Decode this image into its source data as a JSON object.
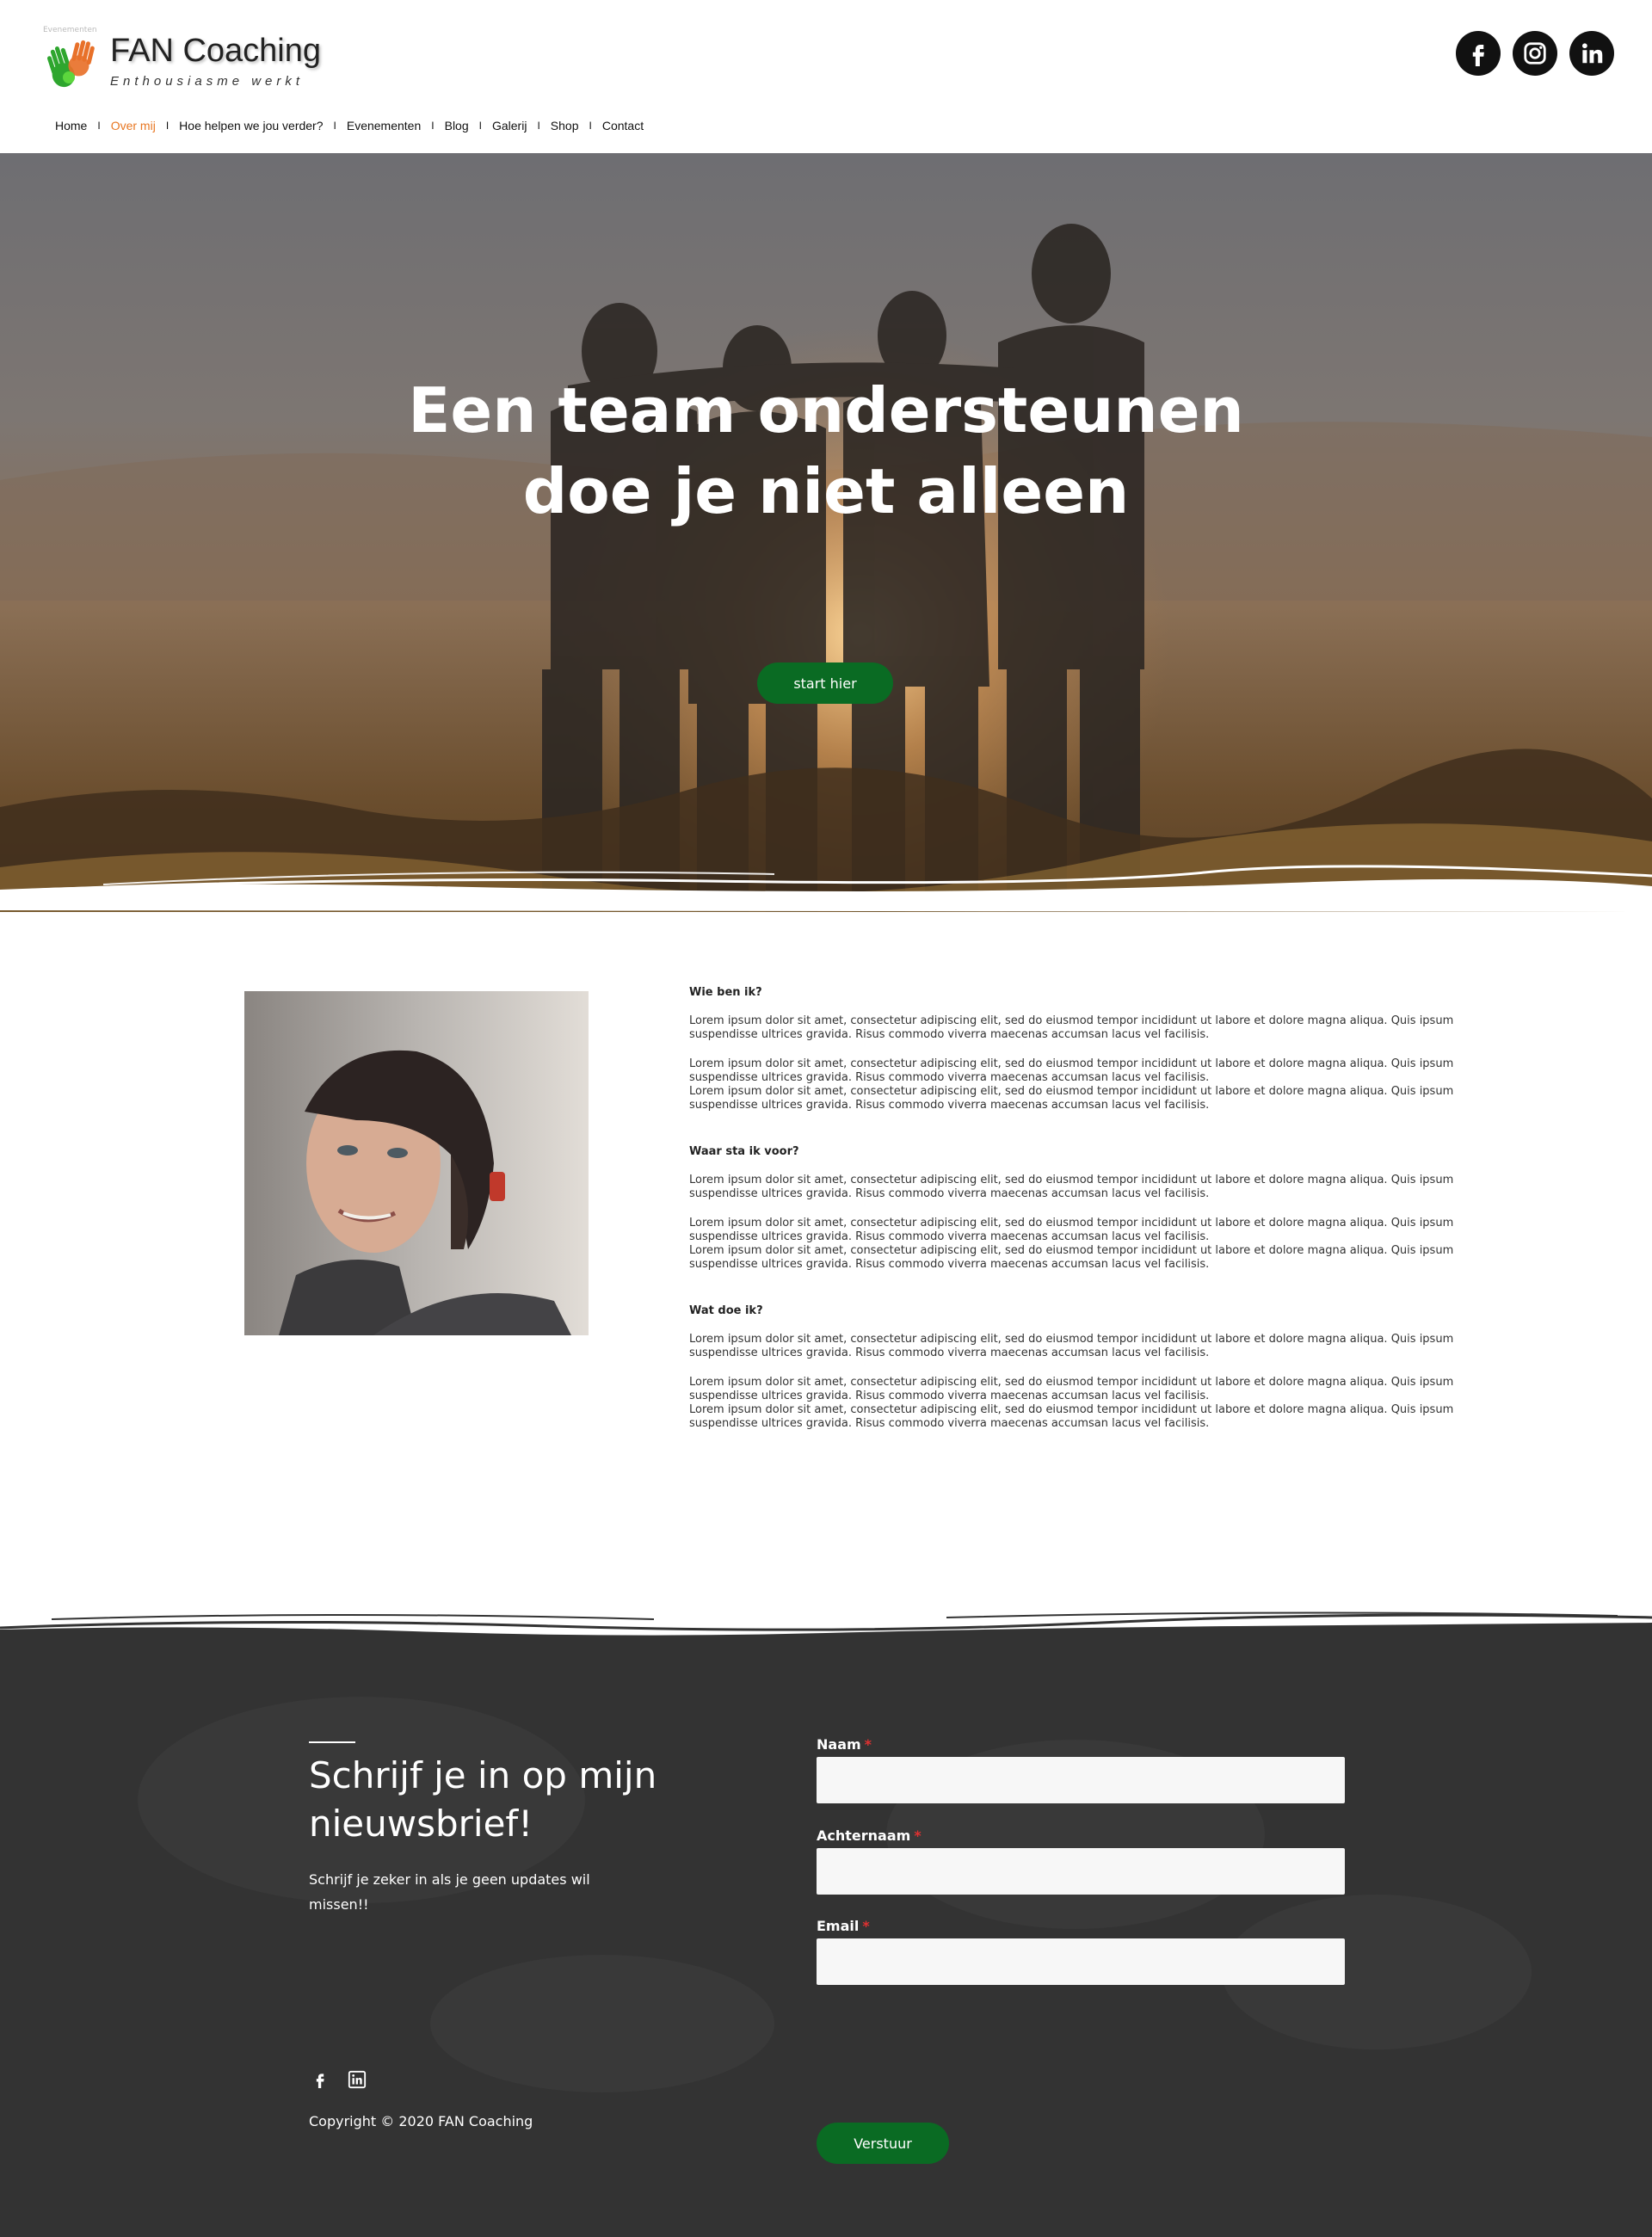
{
  "header": {
    "tiny_label": "Evenementen",
    "logo_title": "FAN Coaching",
    "logo_tagline": "Enthousiasme werkt",
    "social": [
      "facebook-icon",
      "instagram-icon",
      "linkedin-icon"
    ]
  },
  "nav": {
    "items": [
      {
        "label": "Home"
      },
      {
        "label": "Over mij",
        "active": true
      },
      {
        "label": "Hoe helpen we jou verder?"
      },
      {
        "label": "Evenementen"
      },
      {
        "label": "Blog"
      },
      {
        "label": "Galerij"
      },
      {
        "label": "Shop"
      },
      {
        "label": "Contact"
      }
    ],
    "separator": "I",
    "active_color": "#e87722"
  },
  "hero": {
    "title": "Een team ondersteunen doe je niet alleen",
    "button": "start hier"
  },
  "about": {
    "sections": [
      {
        "heading": "Wie ben ik?",
        "p1": "Lorem ipsum dolor sit amet, consectetur adipiscing elit, sed do eiusmod tempor incididunt ut labore et dolore magna aliqua. Quis ipsum suspendisse ultrices gravida. Risus commodo viverra maecenas accumsan lacus vel facilisis.",
        "p2": "Lorem ipsum dolor sit amet, consectetur adipiscing elit, sed do eiusmod tempor incididunt ut labore et dolore magna aliqua. Quis ipsum suspendisse ultrices gravida. Risus commodo viverra maecenas accumsan lacus vel facilisis.",
        "p3": "Lorem ipsum dolor sit amet, consectetur adipiscing elit, sed do eiusmod tempor incididunt ut labore et dolore magna aliqua. Quis ipsum suspendisse ultrices gravida. Risus commodo viverra maecenas accumsan lacus vel facilisis."
      },
      {
        "heading": "Waar sta ik voor?",
        "p1": "Lorem ipsum dolor sit amet, consectetur adipiscing elit, sed do eiusmod tempor incididunt ut labore et dolore magna aliqua. Quis ipsum suspendisse ultrices gravida. Risus commodo viverra maecenas accumsan lacus vel facilisis.",
        "p2": "Lorem ipsum dolor sit amet, consectetur adipiscing elit, sed do eiusmod tempor incididunt ut labore et dolore magna aliqua. Quis ipsum suspendisse ultrices gravida. Risus commodo viverra maecenas accumsan lacus vel facilisis.",
        "p3": "Lorem ipsum dolor sit amet, consectetur adipiscing elit, sed do eiusmod tempor incididunt ut labore et dolore magna aliqua. Quis ipsum suspendisse ultrices gravida. Risus commodo viverra maecenas accumsan lacus vel facilisis."
      },
      {
        "heading": "Wat doe ik?",
        "p1": "Lorem ipsum dolor sit amet, consectetur adipiscing elit, sed do eiusmod tempor incididunt ut labore et dolore magna aliqua. Quis ipsum suspendisse ultrices gravida. Risus commodo viverra maecenas accumsan lacus vel facilisis.",
        "p2": "Lorem ipsum dolor sit amet, consectetur adipiscing elit, sed do eiusmod tempor incididunt ut labore et dolore magna aliqua. Quis ipsum suspendisse ultrices gravida. Risus commodo viverra maecenas accumsan lacus vel facilisis.",
        "p3": "Lorem ipsum dolor sit amet, consectetur adipiscing elit, sed do eiusmod tempor incididunt ut labore et dolore magna aliqua. Quis ipsum suspendisse ultrices gravida. Risus commodo viverra maecenas accumsan lacus vel facilisis."
      }
    ]
  },
  "newsletter": {
    "title": "Schrijf je in op mijn nieuwsbrief!",
    "subtitle": "Schrijf je zeker in als je geen updates wil missen!!",
    "fields": [
      {
        "label": "Naam",
        "required_mark": "*",
        "value": ""
      },
      {
        "label": "Achternaam",
        "required_mark": "*",
        "value": ""
      },
      {
        "label": "Email",
        "required_mark": "*",
        "value": ""
      }
    ],
    "submit": "Verstuur"
  },
  "footer": {
    "social": [
      "facebook-icon",
      "linkedin-icon"
    ],
    "copyright": "Copyright © 2020 FAN Coaching"
  },
  "colors": {
    "accent_green": "#0a6b23",
    "nav_active": "#e87722",
    "footer_bg": "#333333"
  }
}
